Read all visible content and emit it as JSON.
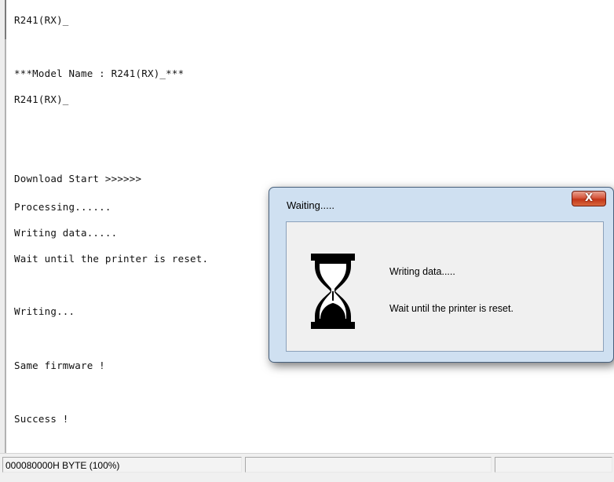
{
  "log": {
    "lines": [
      "R241(RX)_",
      "***Model Name : R241(RX)_***",
      "R241(RX)_",
      "Download Start >>>>>>",
      "Processing......",
      "Writing data.....",
      "Wait until the printer is reset.",
      "Writing...",
      "Same firmware !",
      "Success !"
    ]
  },
  "dialog": {
    "title": "Waiting.....",
    "close_glyph": "X",
    "icon": "hourglass-icon",
    "message_1": "Writing data.....",
    "message_2": "Wait until the printer is reset."
  },
  "statusbar": {
    "progress_text": "000080000H BYTE (100%)",
    "pane_2": "",
    "pane_3": ""
  },
  "colors": {
    "dialog_frame": "#cfe0f1",
    "close_button": "#c23518",
    "client_area": "#f0f0f0"
  }
}
